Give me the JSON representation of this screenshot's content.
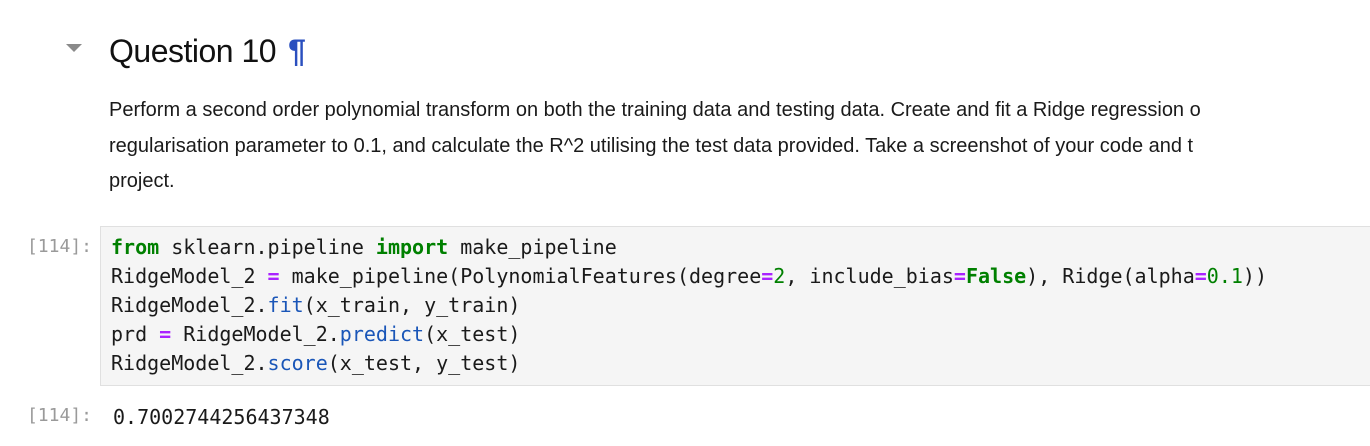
{
  "heading": {
    "title": "Question 10",
    "anchor": "¶"
  },
  "paragraph": {
    "lines": [
      "Perform a second order polynomial transform on both the training data and testing data. Create and fit a Ridge regression o",
      "regularisation parameter to 0.1, and calculate the R^2 utilising the test data provided. Take a screenshot of your code and t",
      "project."
    ]
  },
  "code_cell": {
    "input_prompt": "[114]:",
    "tokens": {
      "l1_from": "from",
      "l1_module": " sklearn.pipeline ",
      "l1_import": "import",
      "l1_name": " make_pipeline",
      "l2_var": "RidgeModel_2 ",
      "l2_eq": "=",
      "l2_call": " make_pipeline(PolynomialFeatures(degree",
      "l2_eq2": "=",
      "l2_num2": "2",
      "l2_bias": ", include_bias",
      "l2_eq3": "=",
      "l2_false": "False",
      "l2_ridge": "), Ridge(alpha",
      "l2_eq4": "=",
      "l2_num01": "0.1",
      "l2_close": "))",
      "l3_obj": "RidgeModel_2.",
      "l3_fit": "fit",
      "l3_args": "(x_train, y_train)",
      "l4_prd": "prd ",
      "l4_eq": "=",
      "l4_obj": " RidgeModel_2.",
      "l4_predict": "predict",
      "l4_args": "(x_test)",
      "l5_obj": "RidgeModel_2.",
      "l5_score": "score",
      "l5_args": "(x_test, y_test)"
    }
  },
  "output_cell": {
    "output_prompt": "[114]:",
    "value": "0.7002744256437348"
  },
  "colors": {
    "keyword": "#008000",
    "operator": "#aa22ff",
    "number": "#008000",
    "method": "#1a56b8",
    "anchor": "#2a4fbf",
    "prompt": "#9a9a9a",
    "cell_background": "#f5f5f5"
  },
  "icons": {
    "collapser": "caret-down-icon"
  }
}
